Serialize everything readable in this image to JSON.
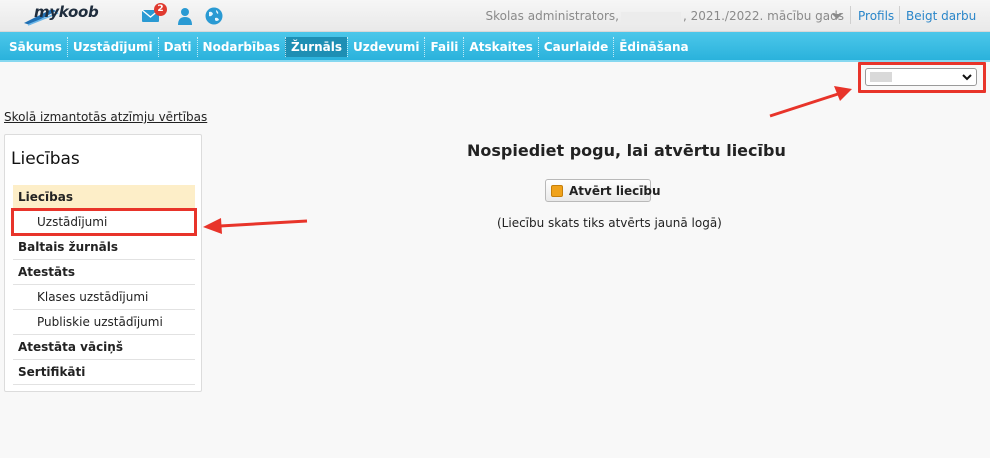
{
  "app": {
    "logo": "mykoob"
  },
  "header": {
    "mail_badge": "2",
    "user_role": "Skolas administrators,",
    "school_year": ", 2021./2022. mācību gads",
    "profile_link": "Profils",
    "logout_link": "Beigt darbu"
  },
  "nav": {
    "items": [
      {
        "label": "Sākums"
      },
      {
        "label": "Uzstādījumi"
      },
      {
        "label": "Dati"
      },
      {
        "label": "Nodarbības"
      },
      {
        "label": "Žurnāls"
      },
      {
        "label": "Uzdevumi"
      },
      {
        "label": "Faili"
      },
      {
        "label": "Atskaites"
      },
      {
        "label": "Caurlaide"
      },
      {
        "label": "Ēdināšana"
      }
    ],
    "active": "Žurnāls"
  },
  "top_link": "Skolā izmantotās atzīmju vērtības",
  "sidebar": {
    "title": "Liecības",
    "items": [
      {
        "label": "Liecības"
      },
      {
        "label": "Uzstādījumi"
      },
      {
        "label": "Baltais žurnāls"
      },
      {
        "label": "Atestāts"
      },
      {
        "label": "Klases uzstādījumi"
      },
      {
        "label": "Publiskie uzstādījumi"
      },
      {
        "label": "Atestāta vāciņš"
      },
      {
        "label": "Sertifikāti"
      }
    ]
  },
  "main": {
    "title": "Nospiediet pogu, lai atvērtu liecību",
    "button_label": "Atvērt liecību",
    "note": "(Liecību skats tiks atvērts jaunā logā)"
  },
  "colors": {
    "nav_bg": "#2ab2dc",
    "nav_active": "#1e8fb4",
    "link": "#2a86c9",
    "highlight": "#e8342a",
    "sidebar_active": "#fdeec8"
  }
}
